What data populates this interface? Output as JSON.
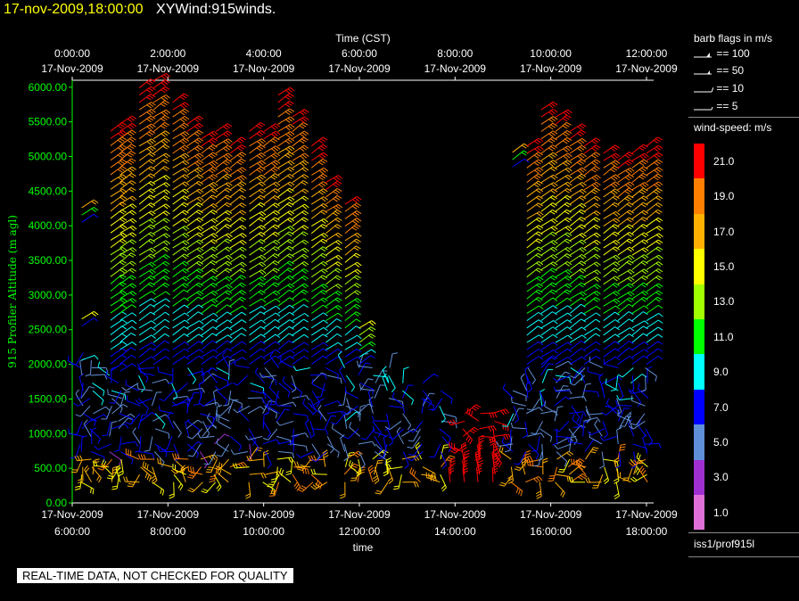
{
  "header": {
    "timestamp": "17-nov-2009,18:00:00",
    "product": "XYWind:915winds."
  },
  "notice": "REAL-TIME DATA, NOT CHECKED FOR QUALITY",
  "legend": {
    "barb_title": "barb flags in m/s",
    "barb_flags": [
      "== 100",
      "== 50",
      "== 10",
      "== 5"
    ],
    "speed_title": "wind-speed: m/s",
    "speed_labels": [
      "21.0",
      "19.0",
      "17.0",
      "15.0",
      "13.0",
      "11.0",
      "9.0",
      "7.0",
      "5.0",
      "3.0",
      "1.0"
    ],
    "speed_colors": [
      "#ff0000",
      "#ff8000",
      "#ffb000",
      "#ffff00",
      "#a0ff00",
      "#00ff00",
      "#00ffff",
      "#0000ff",
      "#5f8fd8",
      "#9f2fd0",
      "#e070d8"
    ],
    "source": "iss1/prof915l"
  },
  "chart_data": {
    "type": "wind-barb",
    "title": "",
    "x_top_label": "Time (CST)",
    "x_bottom_label": "time",
    "ylabel": "915 Profiler Altitude (m agl)",
    "ylim": [
      0,
      6100
    ],
    "yticks": [
      "0.00",
      "500.00",
      "1000.00",
      "1500.00",
      "2000.00",
      "2500.00",
      "3000.00",
      "3500.00",
      "4000.00",
      "4500.00",
      "5000.00",
      "5500.00",
      "6000.00"
    ],
    "xlim_utc_hours": [
      6,
      18.15
    ],
    "xticks_bottom": [
      {
        "t": 6,
        "date": "17-Nov-2009",
        "time": "6:00:00"
      },
      {
        "t": 8,
        "date": "17-Nov-2009",
        "time": "8:00:00"
      },
      {
        "t": 10,
        "date": "17-Nov-2009",
        "time": "10:00:00"
      },
      {
        "t": 12,
        "date": "17-Nov-2009",
        "time": "12:00:00"
      },
      {
        "t": 14,
        "date": "17-Nov-2009",
        "time": "14:00:00"
      },
      {
        "t": 16,
        "date": "17-Nov-2009",
        "time": "16:00:00"
      },
      {
        "t": 18,
        "date": "17-Nov-2009",
        "time": "18:00:00"
      }
    ],
    "xticks_top": [
      {
        "t": 6,
        "date": "17-Nov-2009",
        "time": "0:00:00"
      },
      {
        "t": 8,
        "date": "17-Nov-2009",
        "time": "2:00:00"
      },
      {
        "t": 10,
        "date": "17-Nov-2009",
        "time": "4:00:00"
      },
      {
        "t": 12,
        "date": "17-Nov-2009",
        "time": "6:00:00"
      },
      {
        "t": 14,
        "date": "17-Nov-2009",
        "time": "8:00:00"
      },
      {
        "t": 16,
        "date": "17-Nov-2009",
        "time": "10:00:00"
      },
      {
        "t": 18,
        "date": "17-Nov-2009",
        "time": "12:00:00"
      }
    ],
    "profiles": [
      {
        "t": 6.2,
        "low_top": 2200,
        "high": [
          [
            2550,
            2750
          ],
          [
            4050,
            4350
          ]
        ],
        "speed_max": 21
      },
      {
        "t": 6.4,
        "low_top": 2100,
        "high": [],
        "speed_max": 5
      },
      {
        "t": 6.8,
        "low_top": 1900,
        "high": [
          [
            1900,
            5450
          ]
        ],
        "speed_max": 21
      },
      {
        "t": 7.0,
        "low_top": 1800,
        "high": [
          [
            1900,
            5550
          ]
        ],
        "speed_max": 21
      },
      {
        "t": 7.4,
        "low_top": 2000,
        "high": [
          [
            2000,
            6050
          ]
        ],
        "speed_max": 21
      },
      {
        "t": 7.7,
        "low_top": 2000,
        "high": [
          [
            2000,
            6150
          ]
        ],
        "speed_max": 21
      },
      {
        "t": 8.1,
        "low_top": 2000,
        "high": [
          [
            2000,
            5850
          ]
        ],
        "speed_max": 21
      },
      {
        "t": 8.4,
        "low_top": 2000,
        "high": [
          [
            2000,
            5550
          ]
        ],
        "speed_max": 21
      },
      {
        "t": 8.7,
        "low_top": 2000,
        "high": [
          [
            2000,
            5300
          ]
        ],
        "speed_max": 21
      },
      {
        "t": 9.0,
        "low_top": 2000,
        "high": [
          [
            2000,
            5400
          ]
        ],
        "speed_max": 21
      },
      {
        "t": 9.3,
        "low_top": 2000,
        "high": [
          [
            2000,
            5250
          ]
        ],
        "speed_max": 21
      },
      {
        "t": 9.7,
        "low_top": 2000,
        "high": [
          [
            2000,
            5450
          ]
        ],
        "speed_max": 21
      },
      {
        "t": 10.0,
        "low_top": 2000,
        "high": [
          [
            2000,
            5450
          ]
        ],
        "speed_max": 21
      },
      {
        "t": 10.3,
        "low_top": 2000,
        "high": [
          [
            2000,
            5900
          ]
        ],
        "speed_max": 21
      },
      {
        "t": 10.6,
        "low_top": 2000,
        "high": [
          [
            2000,
            5650
          ]
        ],
        "speed_max": 21
      },
      {
        "t": 11.0,
        "low_top": 2000,
        "high": [
          [
            2000,
            5150
          ]
        ],
        "speed_max": 21
      },
      {
        "t": 11.3,
        "low_top": 2000,
        "high": [
          [
            2000,
            4700
          ]
        ],
        "speed_max": 21
      },
      {
        "t": 11.7,
        "low_top": 2000,
        "high": [
          [
            2000,
            4400
          ]
        ],
        "speed_max": 21
      },
      {
        "t": 12.0,
        "low_top": 2000,
        "high": [
          [
            2000,
            2600
          ]
        ],
        "speed_max": 17
      },
      {
        "t": 12.3,
        "low_top": 2000,
        "high": [],
        "speed_max": 13
      },
      {
        "t": 12.6,
        "low_top": 2000,
        "high": [],
        "speed_max": 9
      },
      {
        "t": 12.9,
        "low_top": 1800,
        "high": [],
        "speed_max": 5
      },
      {
        "t": 13.3,
        "low_top": 1800,
        "high": [],
        "speed_max": 5
      },
      {
        "t": 13.7,
        "low_top": 1700,
        "high": [],
        "speed_max": 5
      },
      {
        "t": 13.9,
        "low_top": 500,
        "high": [],
        "speed_max": 21
      },
      {
        "t": 14.2,
        "low_top": 1300,
        "high": [],
        "speed_max": 21
      },
      {
        "t": 14.5,
        "low_top": 1300,
        "high": [],
        "speed_max": 21
      },
      {
        "t": 14.8,
        "low_top": 1300,
        "high": [],
        "speed_max": 21
      },
      {
        "t": 15.2,
        "low_top": 1700,
        "high": [
          [
            4850,
            5150
          ]
        ],
        "speed_max": 21
      },
      {
        "t": 15.5,
        "low_top": 2000,
        "high": [
          [
            2000,
            5250
          ]
        ],
        "speed_max": 21
      },
      {
        "t": 15.8,
        "low_top": 2000,
        "high": [
          [
            2000,
            5750
          ]
        ],
        "speed_max": 21
      },
      {
        "t": 16.1,
        "low_top": 2000,
        "high": [
          [
            2000,
            5650
          ]
        ],
        "speed_max": 21
      },
      {
        "t": 16.4,
        "low_top": 2000,
        "high": [
          [
            2000,
            5450
          ]
        ],
        "speed_max": 21
      },
      {
        "t": 16.7,
        "low_top": 2000,
        "high": [
          [
            2000,
            5200
          ]
        ],
        "speed_max": 21
      },
      {
        "t": 17.1,
        "low_top": 2000,
        "high": [
          [
            2000,
            5100
          ]
        ],
        "speed_max": 21
      },
      {
        "t": 17.4,
        "low_top": 2000,
        "high": [
          [
            2000,
            5000
          ]
        ],
        "speed_max": 21
      },
      {
        "t": 17.7,
        "low_top": 2000,
        "high": [
          [
            2000,
            5100
          ]
        ],
        "speed_max": 21
      },
      {
        "t": 18.0,
        "low_top": 2000,
        "high": [
          [
            2000,
            5150
          ]
        ],
        "speed_max": 21
      }
    ]
  }
}
